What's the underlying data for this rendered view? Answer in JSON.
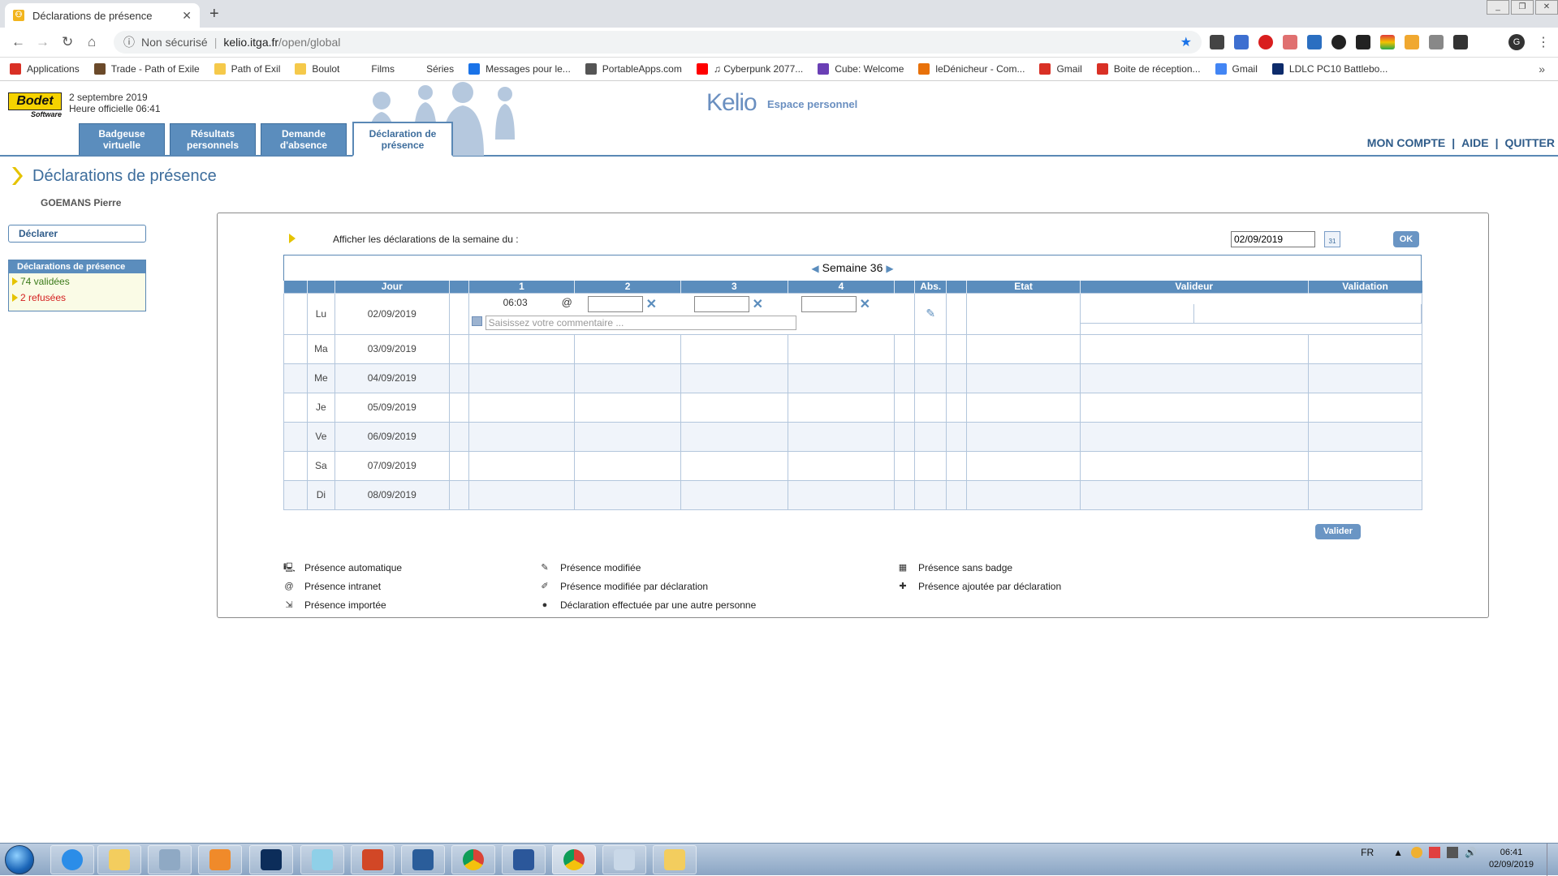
{
  "browser": {
    "tab_title": "Déclarations de présence",
    "new_tab": "+",
    "address": {
      "security": "Non sécurisé",
      "host": "kelio.itga.fr",
      "path": "/open/global"
    },
    "profile_initial": "G",
    "bookmarks": [
      {
        "label": "Applications",
        "color": "#d93025"
      },
      {
        "label": "Trade - Path of Exile",
        "color": "#6b4a2a"
      },
      {
        "label": "Path of Exil",
        "color": "#f5c94a"
      },
      {
        "label": "Boulot",
        "color": "#f5c94a"
      },
      {
        "label": "Films",
        "color": "#ffffff"
      },
      {
        "label": "Séries",
        "color": "#ffffff"
      },
      {
        "label": "Messages pour le...",
        "color": "#1a73e8"
      },
      {
        "label": "PortableApps.com",
        "color": "#555555"
      },
      {
        "label": "♫ Cyberpunk 2077...",
        "color": "#ff0000"
      },
      {
        "label": "Cube: Welcome",
        "color": "#6a3fb5"
      },
      {
        "label": "leDénicheur - Com...",
        "color": "#e8710a"
      },
      {
        "label": "Gmail",
        "color": "#d93025"
      },
      {
        "label": "Boite de réception...",
        "color": "#d93025"
      },
      {
        "label": "Gmail",
        "color": "#4285f4"
      },
      {
        "label": "LDLC PC10 Battlebo...",
        "color": "#0d2b6b"
      }
    ]
  },
  "header": {
    "logo_brand": "Bodet",
    "logo_sub": "Software",
    "date": "2 septembre 2019",
    "time": "Heure officielle 06:41",
    "product": "Kelio",
    "product_sub": "Espace personnel",
    "tabs": [
      {
        "label1": "Badgeuse",
        "label2": "virtuelle"
      },
      {
        "label1": "Résultats",
        "label2": "personnels"
      },
      {
        "label1": "Demande",
        "label2": "d'absence"
      },
      {
        "label1": "Déclaration de",
        "label2": "présence"
      }
    ],
    "links": {
      "account": "MON COMPTE",
      "help": "AIDE",
      "quit": "QUITTER",
      "sep": "|"
    }
  },
  "page": {
    "title": "Déclarations de présence",
    "user": "GOEMANS Pierre",
    "declare": "Déclarer",
    "sidebox_title": "Déclarations de présence",
    "validated": "74 validées",
    "refused": "2 refusées"
  },
  "filter": {
    "label": "Afficher les déclarations de la semaine du :",
    "date": "02/09/2019",
    "calendar_day": "31",
    "ok": "OK"
  },
  "week": {
    "label": "Semaine 36"
  },
  "columns": {
    "jour": "Jour",
    "c1": "1",
    "c2": "2",
    "c3": "3",
    "c4": "4",
    "abs": "Abs.",
    "etat": "Etat",
    "valideur": "Valideur",
    "validation": "Validation"
  },
  "rows": [
    {
      "day": "Lu",
      "date": "02/09/2019",
      "t1": "06:03",
      "t1_flag": "@",
      "comment_placeholder": "Saisissez votre commentaire ..."
    },
    {
      "day": "Ma",
      "date": "03/09/2019"
    },
    {
      "day": "Me",
      "date": "04/09/2019"
    },
    {
      "day": "Je",
      "date": "05/09/2019"
    },
    {
      "day": "Ve",
      "date": "06/09/2019"
    },
    {
      "day": "Sa",
      "date": "07/09/2019"
    },
    {
      "day": "Di",
      "date": "08/09/2019"
    }
  ],
  "valider": "Valider",
  "legend": [
    {
      "icon": "monitor-icon",
      "glyph": "🖳",
      "label": "Présence automatique"
    },
    {
      "icon": "at-icon",
      "glyph": "@",
      "label": "Présence intranet"
    },
    {
      "icon": "import-icon",
      "glyph": "⇲",
      "label": "Présence importée"
    },
    {
      "icon": "pencil-icon",
      "glyph": "✎",
      "label": "Présence modifiée"
    },
    {
      "icon": "pencil-doc-icon",
      "glyph": "✐",
      "label": "Présence modifiée par déclaration"
    },
    {
      "icon": "person-icon",
      "glyph": "●",
      "label": "Déclaration effectuée par une autre personne"
    },
    {
      "icon": "keypad-icon",
      "glyph": "▦",
      "label": "Présence sans badge"
    },
    {
      "icon": "add-doc-icon",
      "glyph": "✚",
      "label": "Présence ajoutée par déclaration"
    }
  ],
  "taskbar": {
    "lang": "FR",
    "time": "06:41",
    "date": "02/09/2019"
  }
}
